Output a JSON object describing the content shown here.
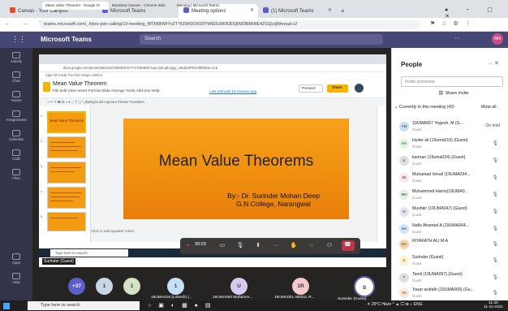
{
  "outer_tabs": [
    {
      "label": "Canvas - Your Campus",
      "color": "#e44d26"
    },
    {
      "label": "Microsoft Teams",
      "color": "#5b5fc7"
    },
    {
      "label": "Meeting options",
      "color": "#5b5fc7"
    },
    {
      "label": "(1) Microsoft Teams",
      "color": "#5b5fc7"
    }
  ],
  "outer_url": "teams.microsoft.com/_#/pre-join-calling/19:meeting_MTM0NWYxZTYtZWI0OS00YWE0LWI0ODQtNDBlMWE4ZGQz@thread.v2",
  "teams": {
    "app_name": "Microsoft Teams",
    "search_placeholder": "Search",
    "avatar_initials": "MN",
    "rail": [
      "Activity",
      "Chat",
      "Teams",
      "Assignments",
      "Calendar",
      "Calls",
      "Files",
      "Apps",
      "Help"
    ]
  },
  "inner_browser": {
    "tabs": [
      "Mean Value Theorem - Google Sl",
      "Bandana Classes - Chrome Web",
      "Meeting | Microsoft Teams"
    ],
    "url": "docs.google.com/presentation/d/1N6Sh9CK7rYsTr9MDZ7suqc4utLqtL0pgy_xiEdqVtPD/edit#slide=id.p",
    "bookmarks": "Apps   M Gmail   YouTube   Maps   untitled"
  },
  "slides": {
    "doc_title": "Mean Value Theorem",
    "menu": "File   Edit   View   Insert   Format   Slide   Arrange   Tools   Add-ons   Help",
    "last_edit": "Last edit was 16 minutes ago",
    "present": "Present",
    "share": "Share",
    "toolbar": "+  ↶  ↷  🖶  ⊞  ⌕  ▾   ⬚  T  ▢  ╲   Background   Layout ▾   Theme   Transition",
    "slide_title": "Mean Value Theorems",
    "slide_by": "By:- Dr. Surinder Mohan Deep",
    "slide_college": "G.N.College, Narangwal",
    "speaker_notes": "Click to add speaker notes",
    "thumb_title": "Mean Value Theorems",
    "thumb_nums": [
      "1",
      "2",
      "3",
      "4",
      "5"
    ]
  },
  "call": {
    "timer": "30:03",
    "inner_search": "Type here to search",
    "presenter_tag": "Surinder (Guest)"
  },
  "tiles": [
    {
      "initials": "+37",
      "color": "#5b5fc7",
      "label": ""
    },
    {
      "initials": "1",
      "color": "#c8d6e5",
      "label": ""
    },
    {
      "initials": "1",
      "color": "#d2e4c4",
      "label": ""
    },
    {
      "initials": "1",
      "color": "#c6e0f5",
      "label": "19UMA016 (Lokesh) (..."
    },
    {
      "initials": "U",
      "color": "#d8c9f0",
      "label": "19UMA050 Muhamm..."
    },
    {
      "initials": "1R",
      "color": "#f3c9c9",
      "label": "19UMA001 ABDUL R..."
    },
    {
      "initials": "S",
      "color": "#ffffff",
      "label": "Surinder (Guest)"
    }
  ],
  "people": {
    "title": "People",
    "invite_placeholder": "Invite someone",
    "share_invite": "Share invite",
    "current": "Currently in this meeting (42)",
    "mute_all": "Mute all",
    "list": [
      {
        "initials": "YM",
        "name": "19UMA057 Yogesh. M (G...",
        "sub": "Guest",
        "color": "#c7e0f4",
        "status": "On hold"
      },
      {
        "initials": "HA",
        "name": "Hyder ali (19uma016) (Guest)",
        "sub": "Guest",
        "color": "#dff6dd",
        "status": ""
      },
      {
        "initials": "K",
        "name": "kamran (19uma024) (Guest)",
        "sub": "Guest",
        "color": "#e1dfdd",
        "status": ""
      },
      {
        "initials": "MI",
        "name": "Muhamad Ismail (19UMA034...",
        "sub": "Guest",
        "color": "#fde7e9",
        "status": ""
      },
      {
        "initials": "MH",
        "name": "Muhammed Harris(19UMA0...",
        "sub": "Guest",
        "color": "#e6f2e6",
        "status": ""
      },
      {
        "initials": "M",
        "name": "Mushkir (19UMA047) (Guest)",
        "sub": "Guest",
        "color": "#e8e4f4",
        "status": ""
      },
      {
        "initials": "NA",
        "name": "Nafis Ahamed A (19UMA064...",
        "sub": "Guest",
        "color": "#cfe4fa",
        "status": ""
      },
      {
        "initials": "RA",
        "name": "RIYAFATH ALI M A",
        "sub": "",
        "color": "#f6d6a8",
        "status": ""
      },
      {
        "initials": "S",
        "name": "Surinder (Guest)",
        "sub": "Guest",
        "color": "#fff4ce",
        "status": ""
      },
      {
        "initials": "T",
        "name": "Tamil (19UMA057) (Guest)",
        "sub": "Guest",
        "color": "#e1dfdd",
        "status": ""
      },
      {
        "initials": "YA",
        "name": "Yasar arafath (19UMA069) (Gu...",
        "sub": "Guest",
        "color": "#fce6d4",
        "status": ""
      }
    ]
  },
  "taskbar": {
    "search": "Type here to search",
    "tray": "☀ 29°C  Haze  ^  ▲  🖵  ⊕  ⌂  ENG",
    "time": "11:40",
    "date": "11-11-2021"
  }
}
